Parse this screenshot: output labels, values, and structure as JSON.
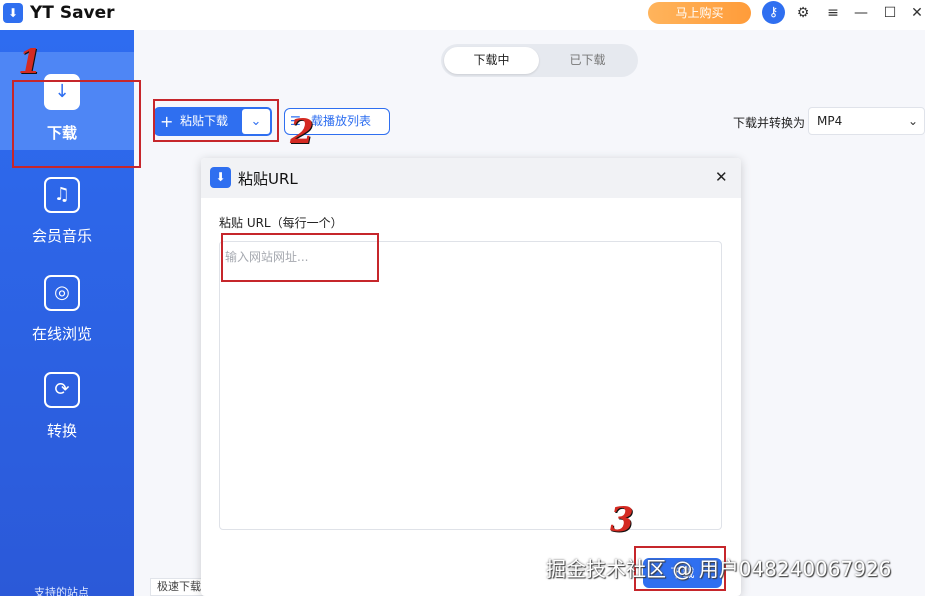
{
  "app": {
    "title": "YT Saver",
    "logo_icon": "download-icon"
  },
  "titlebar": {
    "buy_label": "马上购买",
    "key_icon": "key-icon",
    "settings_icon": "gear-icon",
    "menu_icon": "menu-icon",
    "min_icon": "minimize-icon",
    "max_icon": "maximize-icon",
    "close_icon": "close-icon"
  },
  "sidebar": {
    "items": [
      {
        "label": "下载",
        "icon": "download-icon",
        "active": true
      },
      {
        "label": "会员音乐",
        "icon": "music-icon",
        "active": false
      },
      {
        "label": "在线浏览",
        "icon": "globe-icon",
        "active": false
      },
      {
        "label": "转换",
        "icon": "convert-icon",
        "active": false
      }
    ],
    "footer": "支持的站点"
  },
  "tabs": [
    {
      "label": "下载中",
      "active": true
    },
    {
      "label": "已下载",
      "active": false
    }
  ],
  "toolbar": {
    "paste_label": "粘贴下载",
    "playlist_label": "载播放列表",
    "convert_label": "下载并转换为",
    "format_value": "MP4"
  },
  "bottom": {
    "speed_label": "极速下载"
  },
  "dialog": {
    "title": "粘贴URL",
    "field_label": "粘贴 URL（每行一个）",
    "placeholder": "输入网站网址...",
    "download_label": "下载"
  },
  "annotations": [
    "1",
    "2",
    "3"
  ],
  "watermark": "掘金技术社区 @ 用户048240067926",
  "colors": {
    "accent": "#2f6ff0",
    "sidebar": "#2b59d8",
    "buy": "#ff9c3a",
    "annotation": "#c6262b"
  }
}
